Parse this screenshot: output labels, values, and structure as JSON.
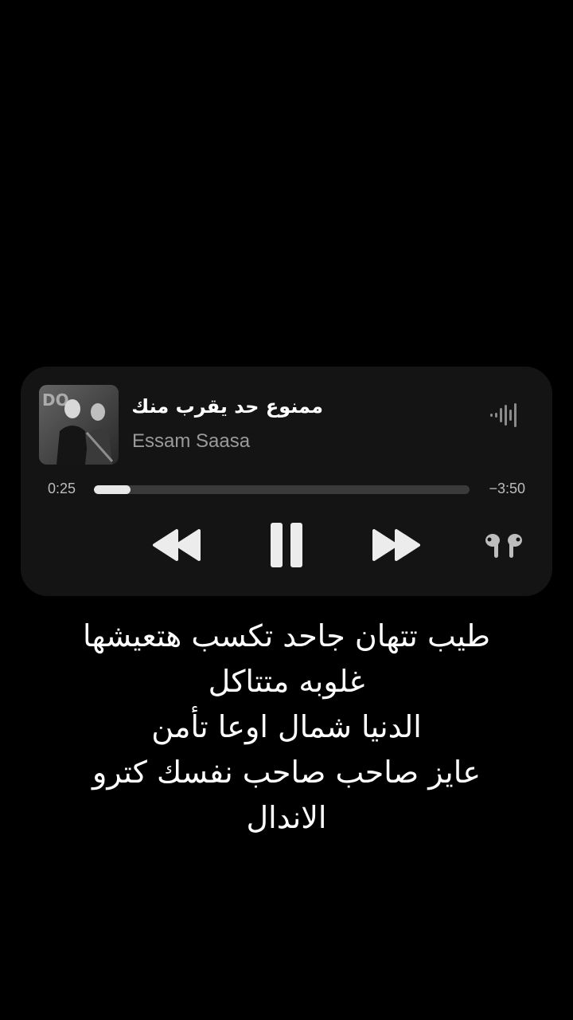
{
  "now_playing": {
    "title": "ممنوع حد يقرب منك",
    "artist": "Essam Saasa",
    "elapsed": "0:25",
    "remaining": "−3:50",
    "progress": 0.098
  },
  "controls": {
    "rewind_icon": "rewind-icon",
    "pause_icon": "pause-icon",
    "forward_icon": "fast-forward-icon",
    "output_icon": "airpods-icon",
    "playing_indicator_icon": "audio-waveform-icon"
  },
  "lyrics": [
    "طيب تتهان جاحد تكسب هتعيشها",
    "غلوبه متتاكل",
    "الدنيا شمال اوعا تأمن",
    "عايز صاحب صاحب نفسك كترو",
    "الاندال"
  ],
  "colors": {
    "background": "#000000",
    "card": "#141414",
    "track": "#3a3a3a",
    "track_fill": "#e8e8e8",
    "secondary_text": "#9a9a9a"
  }
}
